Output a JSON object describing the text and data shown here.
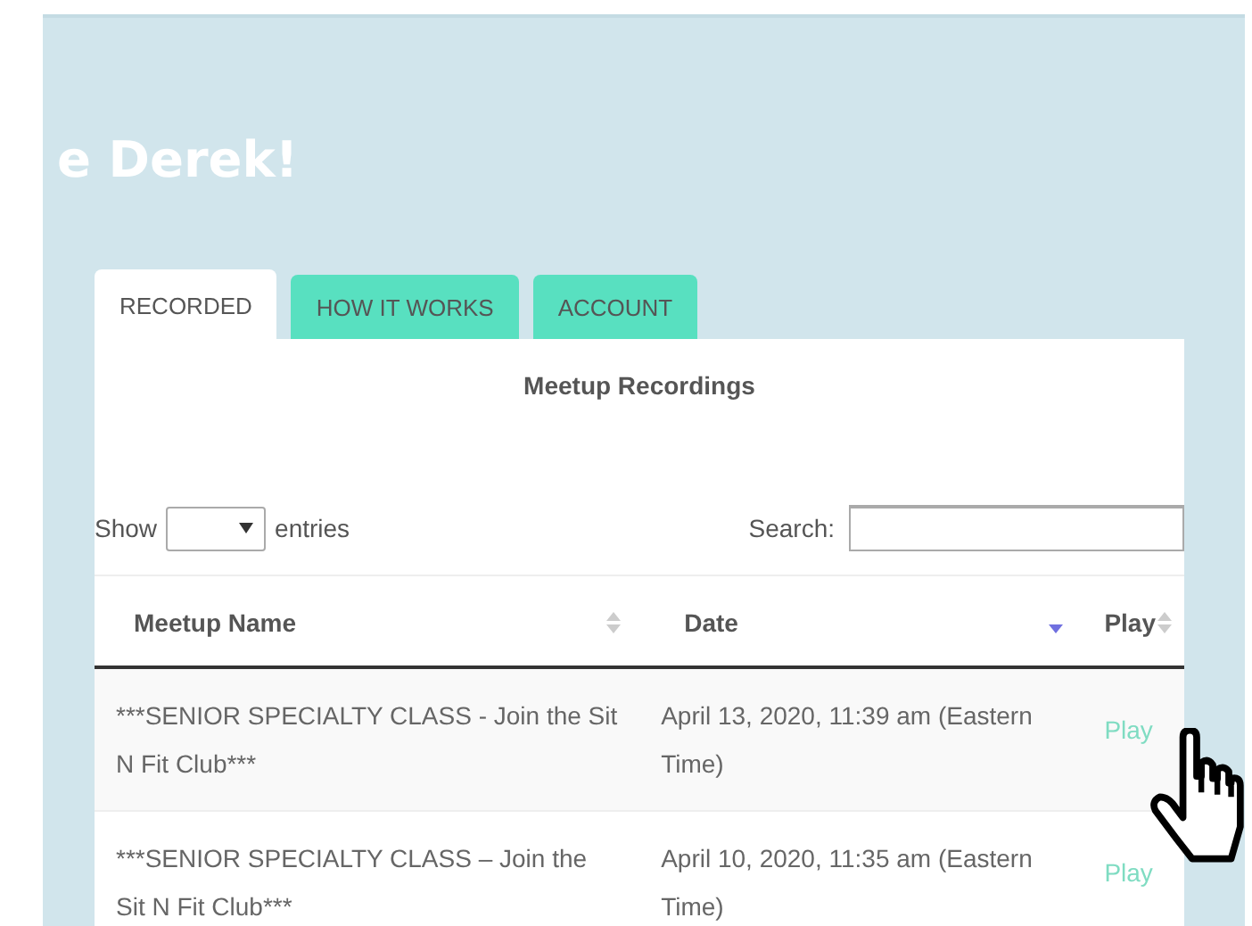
{
  "heading": "e Derek!",
  "tabs": [
    {
      "label": "RECORDED",
      "selected": true
    },
    {
      "label": "HOW IT WORKS",
      "selected": false
    },
    {
      "label": "ACCOUNT",
      "selected": false
    }
  ],
  "panel": {
    "title": "Meetup Recordings",
    "show_label": "Show",
    "entries_label": "entries",
    "search_label": "Search:"
  },
  "table": {
    "columns": [
      {
        "label": "Meetup Name",
        "sorted_descending": false
      },
      {
        "label": "Date",
        "sorted_descending": true
      },
      {
        "label": "Play",
        "sorted_descending": false
      }
    ],
    "rows": [
      {
        "name": "***SENIOR SPECIALTY CLASS - Join the Sit N Fit Club***",
        "date": "April 13, 2020, 11:39 am (Eastern Time)",
        "play": "Play"
      },
      {
        "name": "***SENIOR SPECIALTY CLASS – Join the Sit N Fit Club***",
        "date": "April 10, 2020, 11:35 am (Eastern Time)",
        "play": "Play"
      }
    ]
  }
}
